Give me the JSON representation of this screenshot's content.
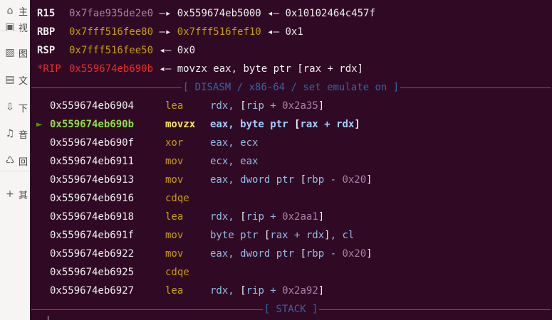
{
  "sidebar": {
    "items": [
      {
        "icon": "home-icon",
        "glyph": "⌂",
        "label": "主"
      },
      {
        "icon": "video-icon",
        "glyph": "▣",
        "label": "视"
      },
      {
        "icon": "image-icon",
        "glyph": "▨",
        "label": "图"
      },
      {
        "icon": "document-icon",
        "glyph": "▤",
        "label": "文"
      },
      {
        "icon": "download-icon",
        "glyph": "⇩",
        "label": "下"
      },
      {
        "icon": "music-icon",
        "glyph": "♫",
        "label": "音"
      },
      {
        "icon": "trash-icon",
        "glyph": "♺",
        "label": "回"
      },
      {
        "icon": "add-icon",
        "glyph": "+",
        "label": "其"
      }
    ]
  },
  "registers": [
    {
      "name": "R15",
      "changed": false,
      "parts": [
        {
          "t": "0x7fae935de2e0",
          "c": "heap"
        },
        {
          "t": " —▸ ",
          "c": "arrow"
        },
        {
          "t": "0x559674eb5000",
          "c": "val"
        },
        {
          "t": " ◂— ",
          "c": "arrow"
        },
        {
          "t": "0x10102464c457f",
          "c": "val"
        }
      ]
    },
    {
      "name": "RBP",
      "changed": false,
      "parts": [
        {
          "t": "0x7fff516fee80",
          "c": "stack"
        },
        {
          "t": " —▸ ",
          "c": "arrow"
        },
        {
          "t": "0x7fff516fef10",
          "c": "stack"
        },
        {
          "t": " ◂— ",
          "c": "arrow"
        },
        {
          "t": "0x1",
          "c": "val"
        }
      ]
    },
    {
      "name": "RSP",
      "changed": false,
      "parts": [
        {
          "t": "0x7fff516fee50",
          "c": "stack"
        },
        {
          "t": " ◂— ",
          "c": "arrow"
        },
        {
          "t": "0x0",
          "c": "val"
        }
      ]
    },
    {
      "name": "*RIP",
      "changed": true,
      "parts": [
        {
          "t": "0x559674eb690b",
          "c": "code"
        },
        {
          "t": " ◂— ",
          "c": "arrow"
        },
        {
          "t": "movzx eax, byte ptr [rax + rdx]",
          "c": "val"
        }
      ]
    }
  ],
  "disasm_header": "[ DISASM / x86-64 / set emulate on ]",
  "current_marker": "►",
  "instructions": [
    {
      "addr": "0x559674eb6904",
      "mnem": "lea",
      "ops": [
        {
          "t": "rdx, "
        },
        {
          "t": "[",
          "c": "br"
        },
        {
          "t": "rip + "
        },
        {
          "t": "0x2a35",
          "c": "num"
        },
        {
          "t": "]",
          "c": "br"
        }
      ],
      "current": false
    },
    {
      "addr": "0x559674eb690b",
      "mnem": "movzx",
      "ops": [
        {
          "t": "eax, byte ptr "
        },
        {
          "t": "[",
          "c": "br"
        },
        {
          "t": "rax + rdx"
        },
        {
          "t": "]",
          "c": "br"
        }
      ],
      "current": true
    },
    {
      "addr": "0x559674eb690f",
      "mnem": "xor",
      "ops": [
        {
          "t": "eax, ecx"
        }
      ],
      "current": false
    },
    {
      "addr": "0x559674eb6911",
      "mnem": "mov",
      "ops": [
        {
          "t": "ecx, eax"
        }
      ],
      "current": false
    },
    {
      "addr": "0x559674eb6913",
      "mnem": "mov",
      "ops": [
        {
          "t": "eax, dword ptr "
        },
        {
          "t": "[",
          "c": "br"
        },
        {
          "t": "rbp - "
        },
        {
          "t": "0x20",
          "c": "num"
        },
        {
          "t": "]",
          "c": "br"
        }
      ],
      "current": false
    },
    {
      "addr": "0x559674eb6916",
      "mnem": "cdqe",
      "ops": [],
      "current": false
    },
    {
      "addr": "0x559674eb6918",
      "mnem": "lea",
      "ops": [
        {
          "t": "rdx, "
        },
        {
          "t": "[",
          "c": "br"
        },
        {
          "t": "rip + "
        },
        {
          "t": "0x2aa1",
          "c": "num"
        },
        {
          "t": "]",
          "c": "br"
        }
      ],
      "current": false
    },
    {
      "addr": "0x559674eb691f",
      "mnem": "mov",
      "ops": [
        {
          "t": "byte ptr "
        },
        {
          "t": "[",
          "c": "br"
        },
        {
          "t": "rax + rdx"
        },
        {
          "t": "]",
          "c": "br"
        },
        {
          "t": ", cl"
        }
      ],
      "current": false
    },
    {
      "addr": "0x559674eb6922",
      "mnem": "mov",
      "ops": [
        {
          "t": "eax, dword ptr "
        },
        {
          "t": "[",
          "c": "br"
        },
        {
          "t": "rbp - "
        },
        {
          "t": "0x20",
          "c": "num"
        },
        {
          "t": "]",
          "c": "br"
        }
      ],
      "current": false
    },
    {
      "addr": "0x559674eb6925",
      "mnem": "cdqe",
      "ops": [],
      "current": false
    },
    {
      "addr": "0x559674eb6927",
      "mnem": "lea",
      "ops": [
        {
          "t": "rdx, "
        },
        {
          "t": "[",
          "c": "br"
        },
        {
          "t": "rip + "
        },
        {
          "t": "0x2a92",
          "c": "num"
        },
        {
          "t": "]",
          "c": "br"
        }
      ],
      "current": false
    }
  ],
  "stack_header": "[ STACK ]"
}
